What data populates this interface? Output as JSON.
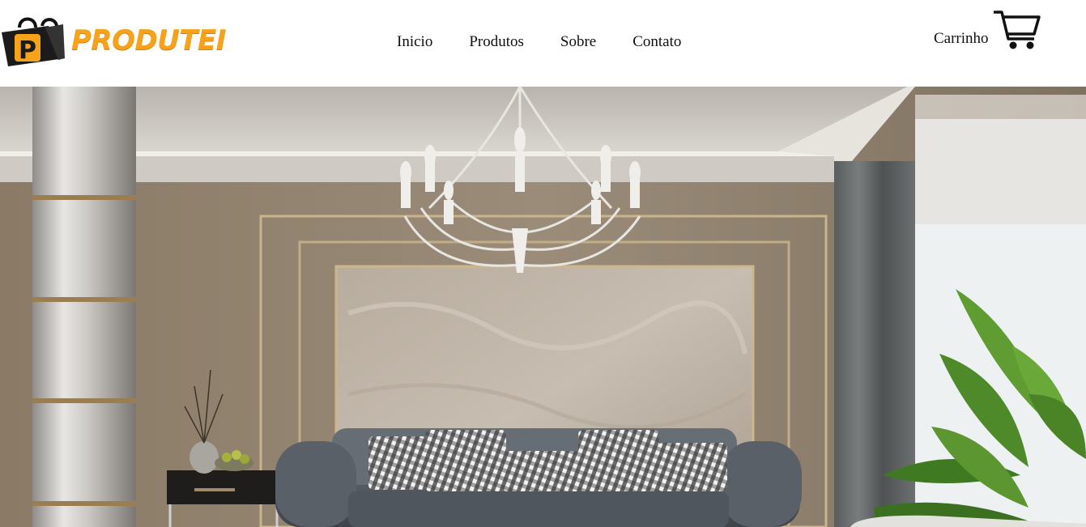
{
  "brand": {
    "name": "PRODUTEI",
    "logo_letter": "P",
    "accent": "#f7a21b"
  },
  "nav": {
    "items": [
      {
        "label": "Inicio"
      },
      {
        "label": "Produtos"
      },
      {
        "label": "Sobre"
      },
      {
        "label": "Contato"
      }
    ]
  },
  "cart": {
    "label": "Carrinho",
    "icon": "shopping-cart-icon"
  },
  "hero": {
    "image": "living-room-interior-photo"
  }
}
